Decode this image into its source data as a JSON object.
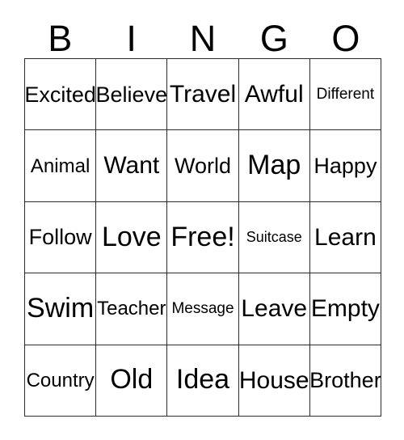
{
  "card": {
    "title": "BINGO",
    "background_color": "#ffffff",
    "text_color": "#000000",
    "border_color": "#2b2b2b",
    "columns": 5,
    "rows": 5
  },
  "header": {
    "letters": [
      {
        "label": "B"
      },
      {
        "label": "I"
      },
      {
        "label": "N"
      },
      {
        "label": "G"
      },
      {
        "label": "O"
      }
    ]
  },
  "grid": {
    "rows": [
      {
        "cells": [
          {
            "label": "Excited",
            "size": "lg"
          },
          {
            "label": "Believe",
            "size": "lg"
          },
          {
            "label": "Travel",
            "size": "xl"
          },
          {
            "label": "Awful",
            "size": "xl"
          },
          {
            "label": "Different",
            "size": "sm"
          }
        ]
      },
      {
        "cells": [
          {
            "label": "Animal",
            "size": "md"
          },
          {
            "label": "Want",
            "size": "xl"
          },
          {
            "label": "World",
            "size": "lg"
          },
          {
            "label": "Map",
            "size": "xxl"
          },
          {
            "label": "Happy",
            "size": "lg"
          }
        ]
      },
      {
        "cells": [
          {
            "label": "Follow",
            "size": "lg"
          },
          {
            "label": "Love",
            "size": "xxl"
          },
          {
            "label": "Free!",
            "size": "xxl"
          },
          {
            "label": "Suitcase",
            "size": "xs"
          },
          {
            "label": "Learn",
            "size": "xl"
          }
        ]
      },
      {
        "cells": [
          {
            "label": "Swim",
            "size": "xxl"
          },
          {
            "label": "Teacher",
            "size": "md"
          },
          {
            "label": "Message",
            "size": "sm"
          },
          {
            "label": "Leave",
            "size": "xl"
          },
          {
            "label": "Empty",
            "size": "xl"
          }
        ]
      },
      {
        "cells": [
          {
            "label": "Country",
            "size": "md"
          },
          {
            "label": "Old",
            "size": "xxl"
          },
          {
            "label": "Idea",
            "size": "xxl"
          },
          {
            "label": "House",
            "size": "xl"
          },
          {
            "label": "Brother",
            "size": "lg"
          }
        ]
      }
    ]
  }
}
